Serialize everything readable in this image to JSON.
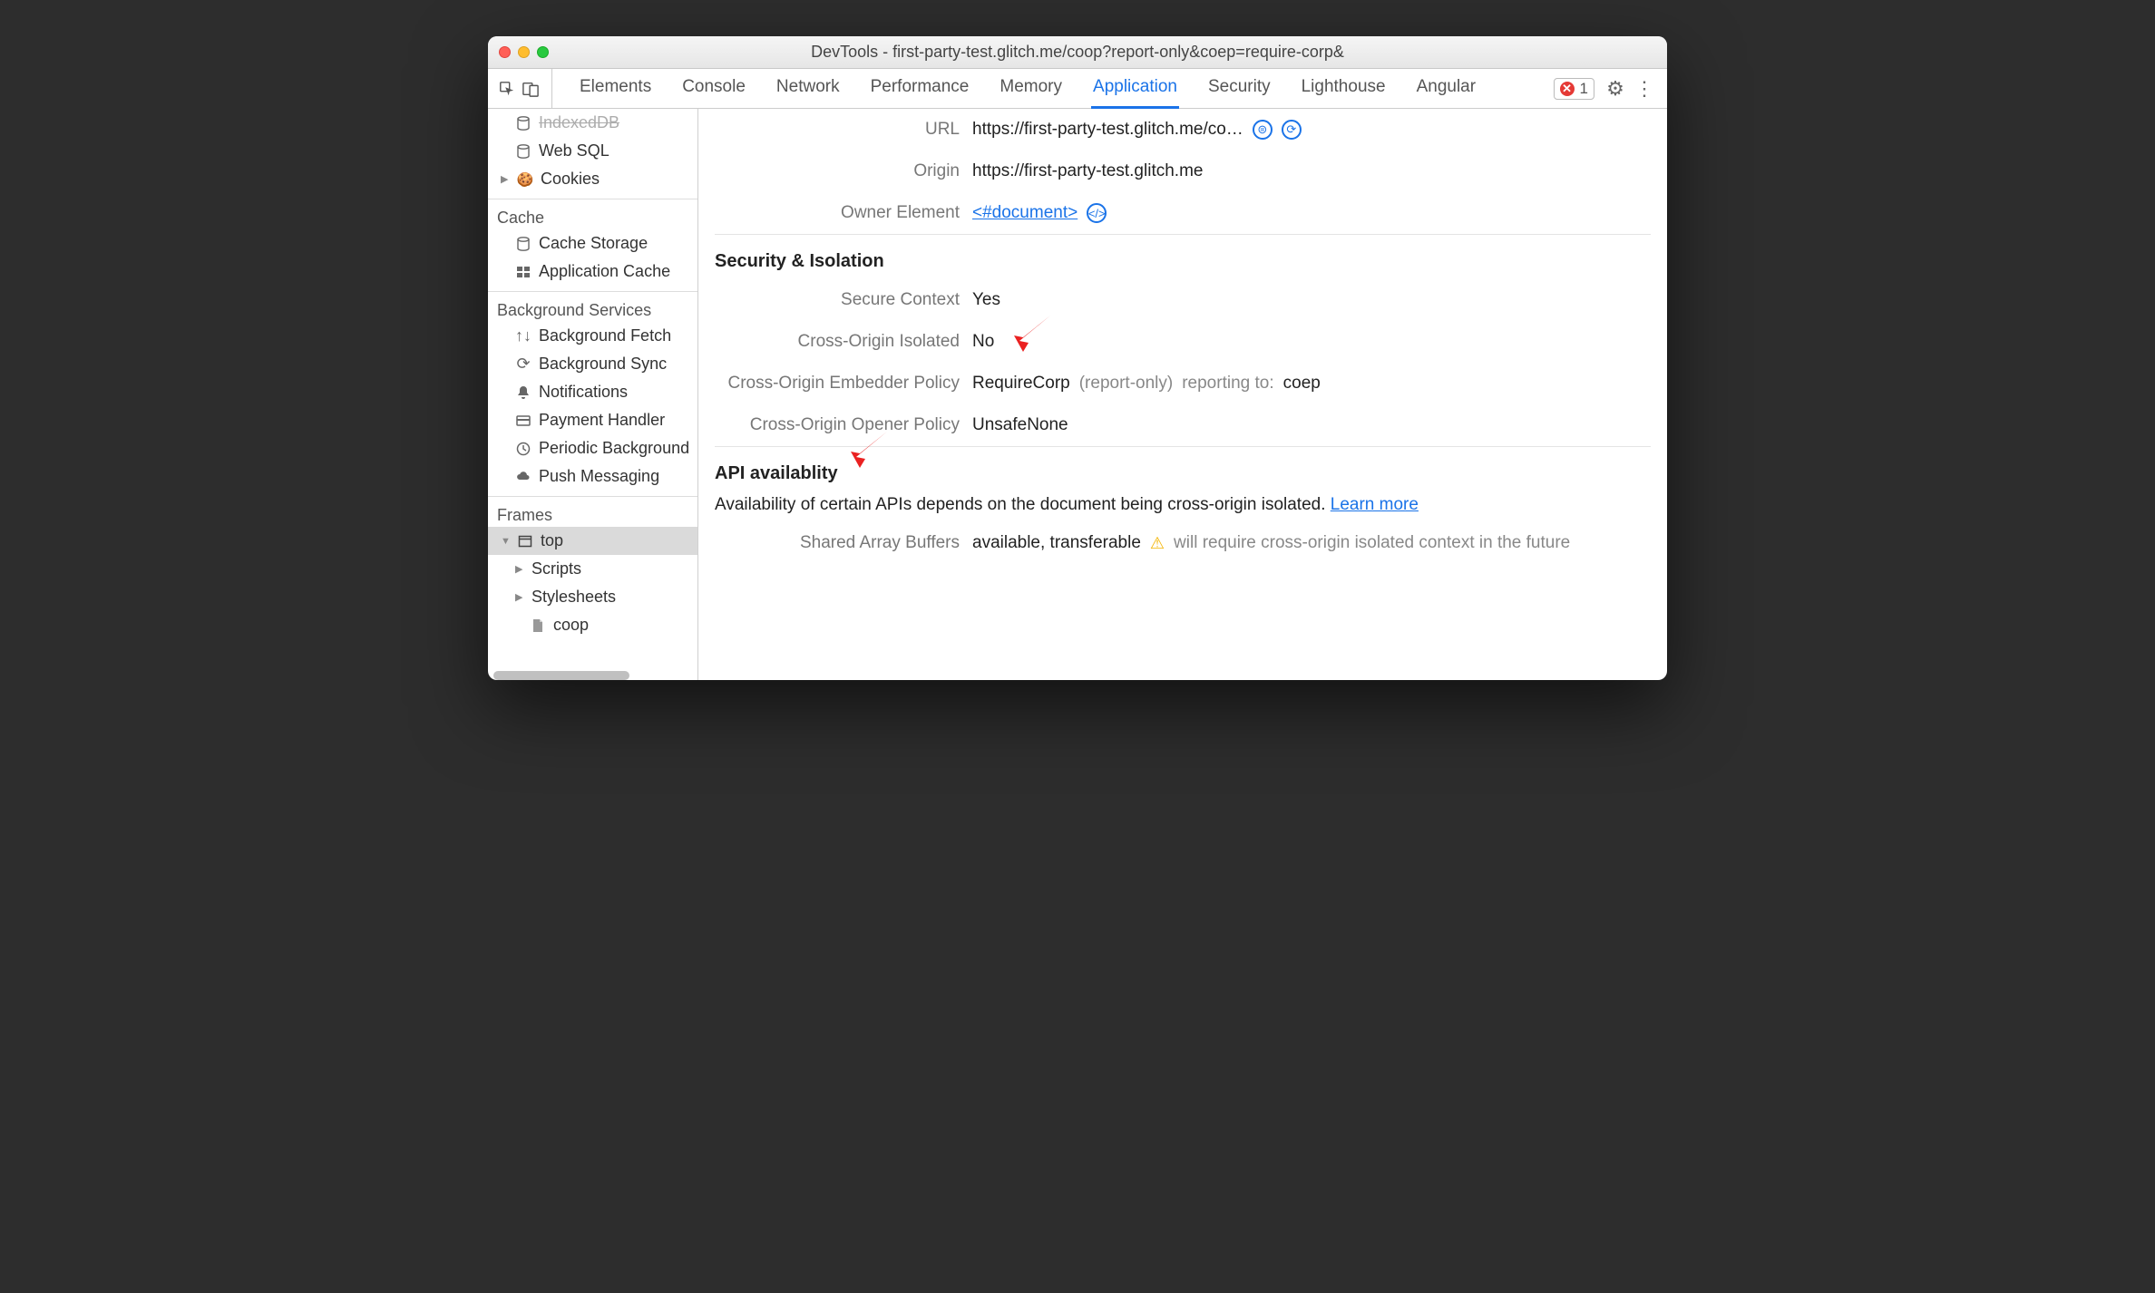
{
  "window": {
    "title": "DevTools - first-party-test.glitch.me/coop?report-only&coep=require-corp&"
  },
  "tabs": {
    "items": [
      "Elements",
      "Console",
      "Network",
      "Performance",
      "Memory",
      "Application",
      "Security",
      "Lighthouse",
      "Angular"
    ],
    "active": "Application"
  },
  "errorBadge": {
    "count": "1"
  },
  "sidebar": {
    "indexedDb": "IndexedDB",
    "webSql": "Web SQL",
    "cookies": "Cookies",
    "cacheGroup": "Cache",
    "cacheStorage": "Cache Storage",
    "appCache": "Application Cache",
    "bgGroup": "Background Services",
    "bgFetch": "Background Fetch",
    "bgSync": "Background Sync",
    "notifications": "Notifications",
    "payment": "Payment Handler",
    "periodic": "Periodic Background",
    "push": "Push Messaging",
    "framesGroup": "Frames",
    "top": "top",
    "scripts": "Scripts",
    "stylesheets": "Stylesheets",
    "coop": "coop"
  },
  "main": {
    "urlLabel": "URL",
    "urlValue": "https://first-party-test.glitch.me/co…",
    "originLabel": "Origin",
    "originValue": "https://first-party-test.glitch.me",
    "ownerLabel": "Owner Element",
    "ownerValue": "<#document>",
    "secSection": "Security & Isolation",
    "secureContextLabel": "Secure Context",
    "secureContextValue": "Yes",
    "coiLabel": "Cross-Origin Isolated",
    "coiValue": "No",
    "coepLabel": "Cross-Origin Embedder Policy",
    "coepValue": "RequireCorp",
    "coepMode": "(report-only)",
    "reportingLabel": "reporting to:",
    "reportingVal": "coep",
    "coopLabel": "Cross-Origin Opener Policy",
    "coopValue": "UnsafeNone",
    "apiSection": "API availablity",
    "apiDesc": "Availability of certain APIs depends on the document being cross-origin isolated. ",
    "learnMore": "Learn more",
    "sabLabel": "Shared Array Buffers",
    "sabValue": "available, transferable",
    "sabWarn": "will require cross-origin isolated context in the future"
  }
}
